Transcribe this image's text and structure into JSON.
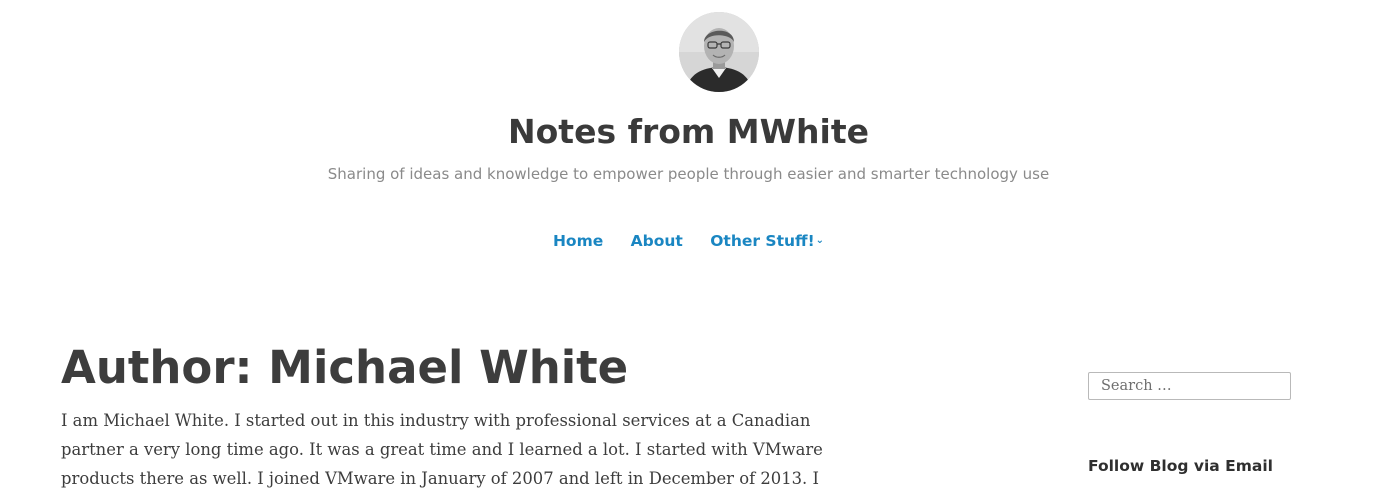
{
  "site": {
    "title": "Notes from MWhite",
    "tagline": "Sharing of ideas and knowledge to empower people through easier and smarter technology use",
    "avatar_icon": "author-photo"
  },
  "nav": {
    "items": [
      {
        "label": "Home"
      },
      {
        "label": "About"
      },
      {
        "label": "Other Stuff!",
        "has_dropdown": true,
        "icon": "chevron-down-icon"
      }
    ],
    "link_color": "#1a86c2"
  },
  "main": {
    "title": "Author: Michael White",
    "bio_lines": [
      "I am Michael White. I started out in this industry with professional services at a Canadian",
      "partner a very long time ago. It was a great time and I learned a lot. I started with VMware",
      "products there as well. I joined VMware in January of 2007 and left in December of 2013. I"
    ]
  },
  "sidebar": {
    "search_placeholder": "Search …",
    "follow_title": "Follow Blog via Email"
  }
}
